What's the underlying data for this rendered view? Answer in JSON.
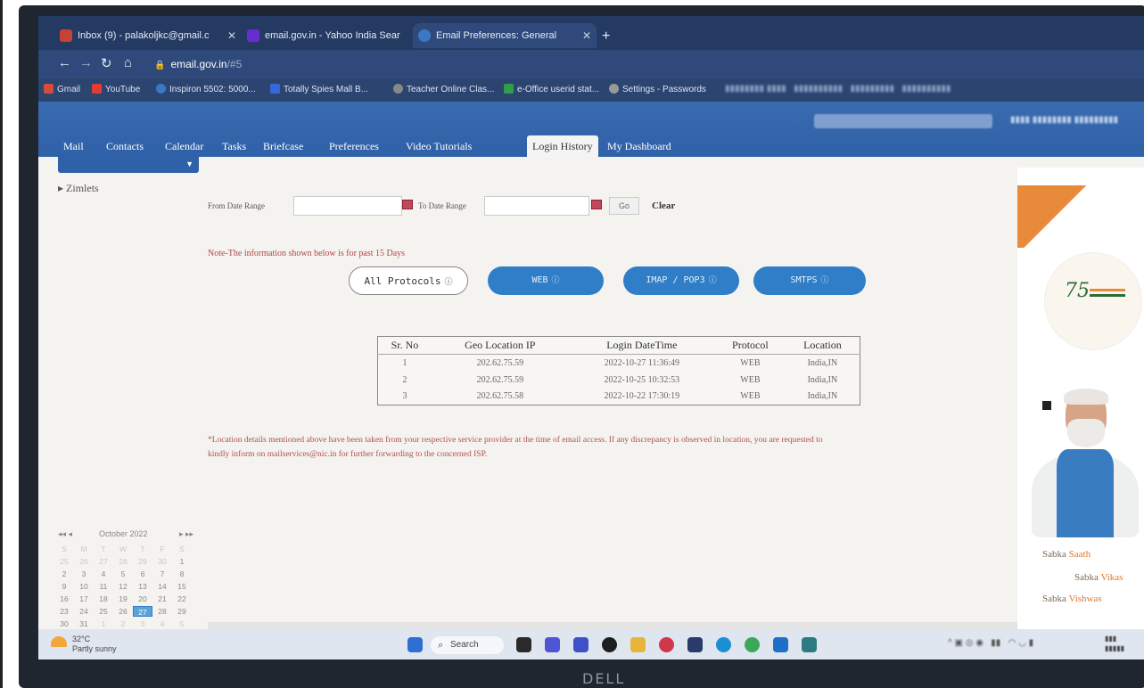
{
  "browser": {
    "tabs": [
      {
        "title": "Inbox (9) - palakoljkc@gmail.c",
        "color": "#c64232"
      },
      {
        "title": "email.gov.in - Yahoo India Sear",
        "color": "#6a2bd1"
      },
      {
        "title": "Email Preferences: General",
        "color": "#3b78c4"
      }
    ],
    "new_tab": "+",
    "url_host": "email.gov.in",
    "url_path": "/#5",
    "bookmarks": [
      {
        "label": "Gmail",
        "color": "#d64b3c"
      },
      {
        "label": "YouTube",
        "color": "#e33c33"
      },
      {
        "label": "Inspiron 5502: 5000...",
        "color": "#3b78c4"
      },
      {
        "label": "Totally Spies Mall B...",
        "color": "#3568d8"
      },
      {
        "label": "Teacher Online Clas...",
        "color": "#888"
      },
      {
        "label": "e-Office userid stat...",
        "color": "#2e9e4a"
      },
      {
        "label": "Settings - Passwords",
        "color": "#999"
      }
    ]
  },
  "app": {
    "nav_tabs": [
      "Mail",
      "Contacts",
      "Calendar",
      "Tasks",
      "Briefcase",
      "Preferences",
      "Video Tutorials",
      "Login History",
      "My Dashboard"
    ],
    "active_tab": "Login History",
    "zimlets": "Zimlets",
    "from_label": "From Date Range",
    "to_label": "To Date Range",
    "go_label": "Go",
    "clear_label": "Clear",
    "note": "Note-The information shown below is for past 15 Days",
    "protocols": [
      {
        "label": "All Protocols",
        "selected": true
      },
      {
        "label": "WEB",
        "selected": false
      },
      {
        "label": "IMAP / POP3",
        "selected": false
      },
      {
        "label": "SMTPS",
        "selected": false
      }
    ],
    "table": {
      "headers": [
        "Sr. No",
        "Geo Location IP",
        "Login DateTime",
        "Protocol",
        "Location"
      ],
      "rows": [
        [
          "1",
          "202.62.75.59",
          "2022-10-27 11:36:49",
          "WEB",
          "India,IN"
        ],
        [
          "2",
          "202.62.75.59",
          "2022-10-25 10:32:53",
          "WEB",
          "India,IN"
        ],
        [
          "3",
          "202.62.75.58",
          "2022-10-22 17:30:19",
          "WEB",
          "India,IN"
        ]
      ]
    },
    "disclaimer_start": "*Location details mentioned above have been taken from your respective service provider at the time of email access. If any discrepancy is observed in location, you are requested to",
    "disclaimer_end": "kindly inform on mailservices@nic.in for further forwarding to the concerned ISP."
  },
  "calendar": {
    "prev": "◂◂ ◂",
    "month": "October 2022",
    "next": "▸ ▸▸",
    "weekdays": [
      "S",
      "M",
      "T",
      "W",
      "T",
      "F",
      "S"
    ],
    "days": [
      [
        "25",
        "26",
        "27",
        "28",
        "29",
        "30",
        "1"
      ],
      [
        "2",
        "3",
        "4",
        "5",
        "6",
        "7",
        "8"
      ],
      [
        "9",
        "10",
        "11",
        "12",
        "13",
        "14",
        "15"
      ],
      [
        "16",
        "17",
        "18",
        "19",
        "20",
        "21",
        "22"
      ],
      [
        "23",
        "24",
        "25",
        "26",
        "27",
        "28",
        "29"
      ],
      [
        "30",
        "31",
        "1",
        "2",
        "3",
        "4",
        "5"
      ]
    ],
    "today": "27"
  },
  "banner": {
    "logo_text": "75",
    "slogans": [
      {
        "a": "Sabka ",
        "b": "Saath"
      },
      {
        "a": "Sabka ",
        "b": "Vikas"
      },
      {
        "a": "Sabka ",
        "b": "Vishwas"
      }
    ]
  },
  "taskbar": {
    "temp": "32°C",
    "weather": "Partly sunny",
    "search": "Search",
    "icons": [
      {
        "name": "windows-start-icon",
        "color": "#2e6fd1"
      },
      {
        "name": "file-explorer-icon",
        "color": "#2a2a2a"
      },
      {
        "name": "chat-icon",
        "color": "#4f56d4"
      },
      {
        "name": "teams-icon",
        "color": "#3e52c7"
      },
      {
        "name": "media-icon",
        "color": "#1e1e1e"
      },
      {
        "name": "folder-icon",
        "color": "#e7b53a"
      },
      {
        "name": "paint-icon",
        "color": "#d1364b"
      },
      {
        "name": "store-icon",
        "color": "#2a3a6a"
      },
      {
        "name": "edge-icon",
        "color": "#1b8fd4"
      },
      {
        "name": "chrome-icon",
        "color": "#3aa856"
      },
      {
        "name": "outlook-icon",
        "color": "#1f6fc9"
      },
      {
        "name": "office-icon",
        "color": "#2c7a82"
      }
    ],
    "brand": "DELL"
  }
}
